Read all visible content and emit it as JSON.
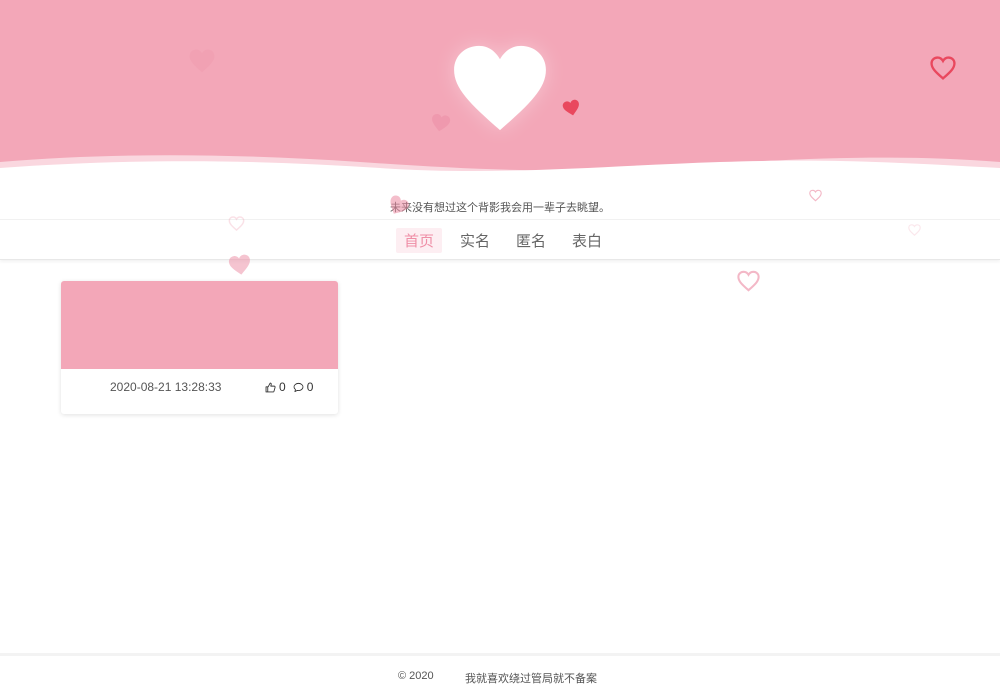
{
  "header": {
    "subtitle": "未来没有想过这个背影我会用一辈子去眺望。"
  },
  "nav": {
    "items": [
      {
        "label": "首页",
        "active": true
      },
      {
        "label": "实名",
        "active": false
      },
      {
        "label": "匿名",
        "active": false
      },
      {
        "label": "表白",
        "active": false
      }
    ]
  },
  "posts": [
    {
      "date": "2020-08-21 13:28:33",
      "likes": "0",
      "comments": "0"
    }
  ],
  "footer": {
    "copyright": "© 2020",
    "note": "我就喜欢绕过管局就不备案"
  },
  "colors": {
    "banner": "#f3a7b8",
    "accent": "#ef8ea6",
    "heart_red": "#e9485e"
  }
}
